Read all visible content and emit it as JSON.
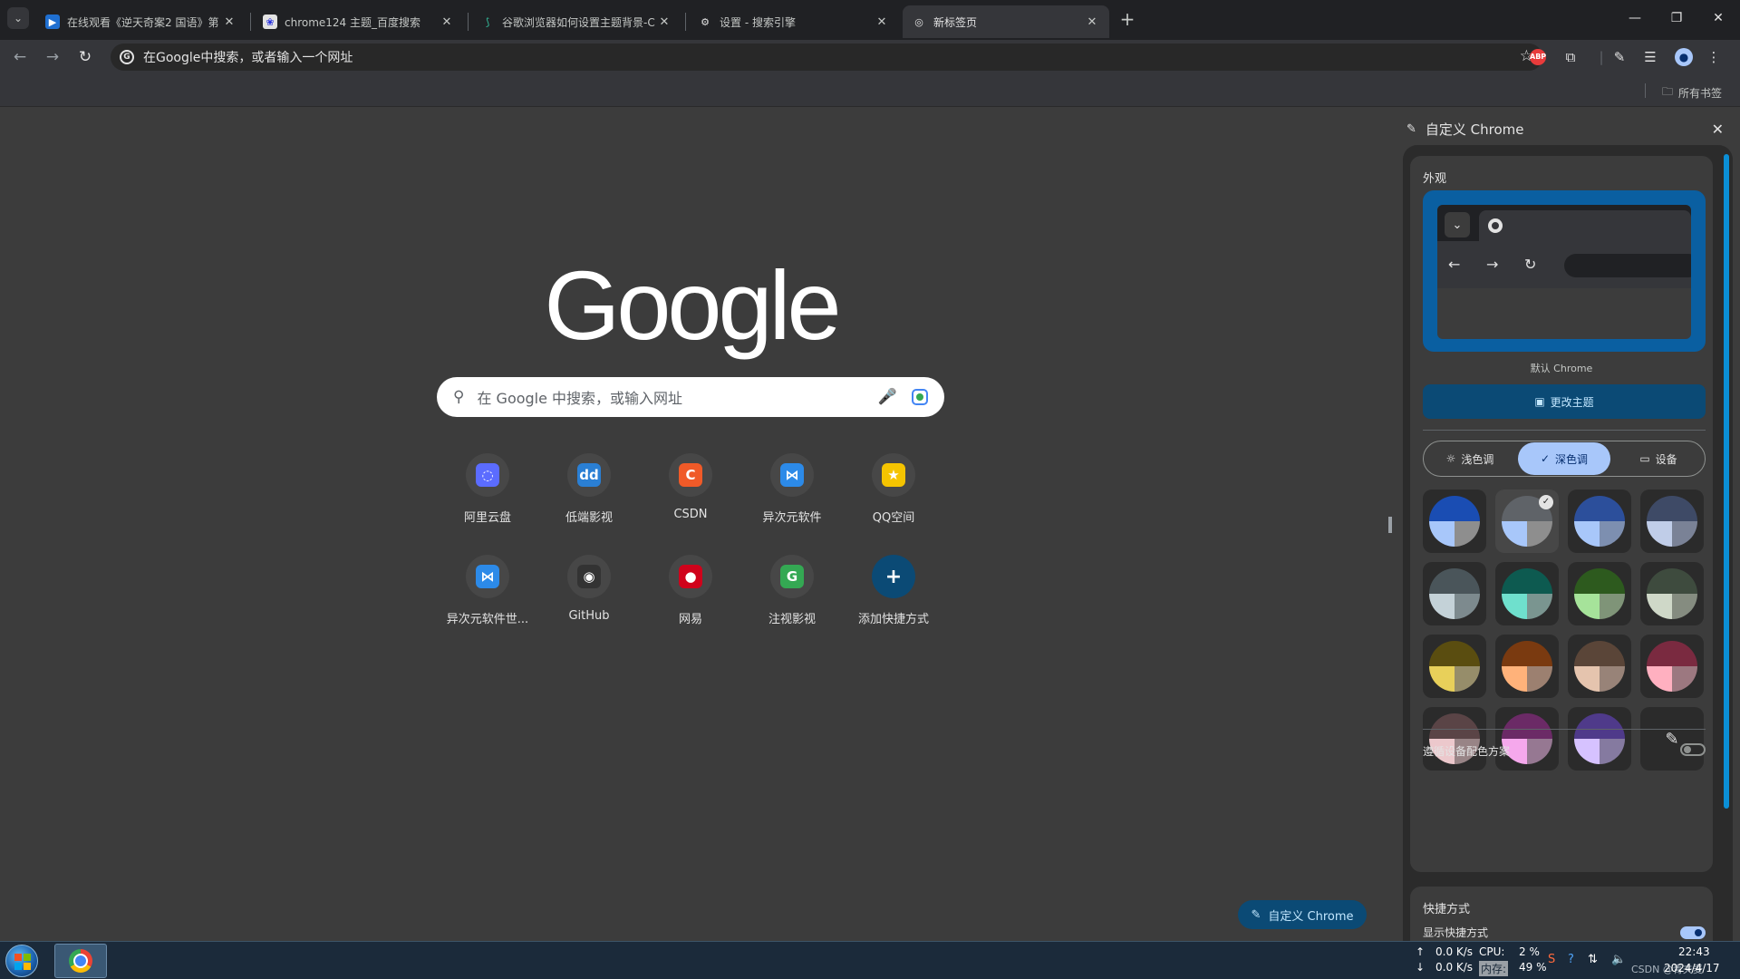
{
  "colors": {
    "accent": "#0b4a75",
    "accent_text": "#c2e7ff",
    "selected_mode": "#a8c7fa",
    "panel_bg": "#2b2b2b",
    "page_bg": "#3c3c3c"
  },
  "tabs": [
    {
      "title": "在线观看《逆天奇案2 国语》第",
      "favicon": "video-icon",
      "active": false
    },
    {
      "title": "chrome124 主题_百度搜索",
      "favicon": "baidu-icon",
      "active": false
    },
    {
      "title": "谷歌浏览器如何设置主题背景-C",
      "favicon": "csdn-icon",
      "active": false
    },
    {
      "title": "设置 - 搜索引擎",
      "favicon": "gear-icon",
      "active": false
    },
    {
      "title": "新标签页",
      "favicon": "chrome-icon",
      "active": true
    }
  ],
  "omnibox": {
    "text": "在Google中搜索，或者输入一个网址"
  },
  "bookmarks": {
    "all_label": "所有书签"
  },
  "ntp": {
    "logo": "Google",
    "search_placeholder": "在 Google 中搜索，或输入网址",
    "shortcuts": [
      {
        "label": "阿里云盘",
        "glyph": "◌",
        "color": "#5b6cff"
      },
      {
        "label": "低端影视",
        "glyph": "dd",
        "color": "#2a7fd4"
      },
      {
        "label": "CSDN",
        "glyph": "C",
        "color": "#f05a28"
      },
      {
        "label": "异次元软件",
        "glyph": "⋈",
        "color": "#2c8ae8"
      },
      {
        "label": "QQ空间",
        "glyph": "★",
        "color": "#f5c400"
      },
      {
        "label": "异次元软件世...",
        "glyph": "⋈",
        "color": "#2c8ae8"
      },
      {
        "label": "GitHub",
        "glyph": "◉",
        "color": "#333333"
      },
      {
        "label": "网易",
        "glyph": "●",
        "color": "#d0021b"
      },
      {
        "label": "注视影视",
        "glyph": "G",
        "color": "#34a853"
      },
      {
        "label": "添加快捷方式",
        "glyph": "+",
        "color": "#0b4a75"
      }
    ],
    "customize_label": "自定义 Chrome"
  },
  "side_panel": {
    "title": "自定义 Chrome",
    "appearance_title": "外观",
    "preview_caption": "默认 Chrome",
    "change_theme_label": "更改主题",
    "modes": [
      {
        "label": "浅色调",
        "icon": "sun-icon",
        "selected": false
      },
      {
        "label": "深色调",
        "icon": "check-icon",
        "selected": true
      },
      {
        "label": "设备",
        "icon": "monitor-icon",
        "selected": false
      }
    ],
    "swatches": [
      {
        "top": "#1a4db3",
        "bl": "#a8c7fa",
        "br": "#8e8e8e",
        "selected": false
      },
      {
        "top": "#5f6368",
        "bl": "#a8c7fa",
        "br": "#8e8e8e",
        "selected": true
      },
      {
        "top": "#2c4f9b",
        "bl": "#a8c7fa",
        "br": "#7d8fb0",
        "selected": false
      },
      {
        "top": "#3e4a66",
        "bl": "#c0cde8",
        "br": "#7a8296",
        "selected": false
      },
      {
        "top": "#4a555a",
        "bl": "#c4d2d8",
        "br": "#7d8a8e",
        "selected": false
      },
      {
        "top": "#0d5a50",
        "bl": "#6fe0cd",
        "br": "#7a9590",
        "selected": false
      },
      {
        "top": "#2d5a1e",
        "bl": "#a6e39a",
        "br": "#7f9478",
        "selected": false
      },
      {
        "top": "#3e4b3e",
        "bl": "#cfd8c8",
        "br": "#858c80",
        "selected": false
      },
      {
        "top": "#5a4d10",
        "bl": "#e8d05a",
        "br": "#968d6a",
        "selected": false
      },
      {
        "top": "#7a3a10",
        "bl": "#ffb27a",
        "br": "#9c8070",
        "selected": false
      },
      {
        "top": "#5a4538",
        "bl": "#e5c4ae",
        "br": "#988378",
        "selected": false
      },
      {
        "top": "#7a2a40",
        "bl": "#ffb0c0",
        "br": "#9c7880",
        "selected": false
      },
      {
        "top": "#5a4446",
        "bl": "#ecc8cc",
        "br": "#988486",
        "selected": false
      },
      {
        "top": "#6b2a66",
        "bl": "#f5a8ec",
        "br": "#967892",
        "selected": false
      },
      {
        "top": "#4f3a8a",
        "bl": "#d6c2ff",
        "br": "#857aa0",
        "selected": false
      }
    ],
    "follow_device_label": "遵循设备配色方案",
    "follow_device_on": false,
    "shortcuts_title": "快捷方式",
    "show_shortcuts_label": "显示快捷方式",
    "show_shortcuts_on": true
  },
  "taskbar": {
    "net_up": "0.0 K/s",
    "net_down": "0.0 K/s",
    "cpu_label": "CPU:",
    "cpu_value": "2 %",
    "mem_label": "内存:",
    "mem_value": "49 %",
    "time": "22:43",
    "date": "2024/4/17",
    "watermark": "CSDN @青夫麦"
  }
}
